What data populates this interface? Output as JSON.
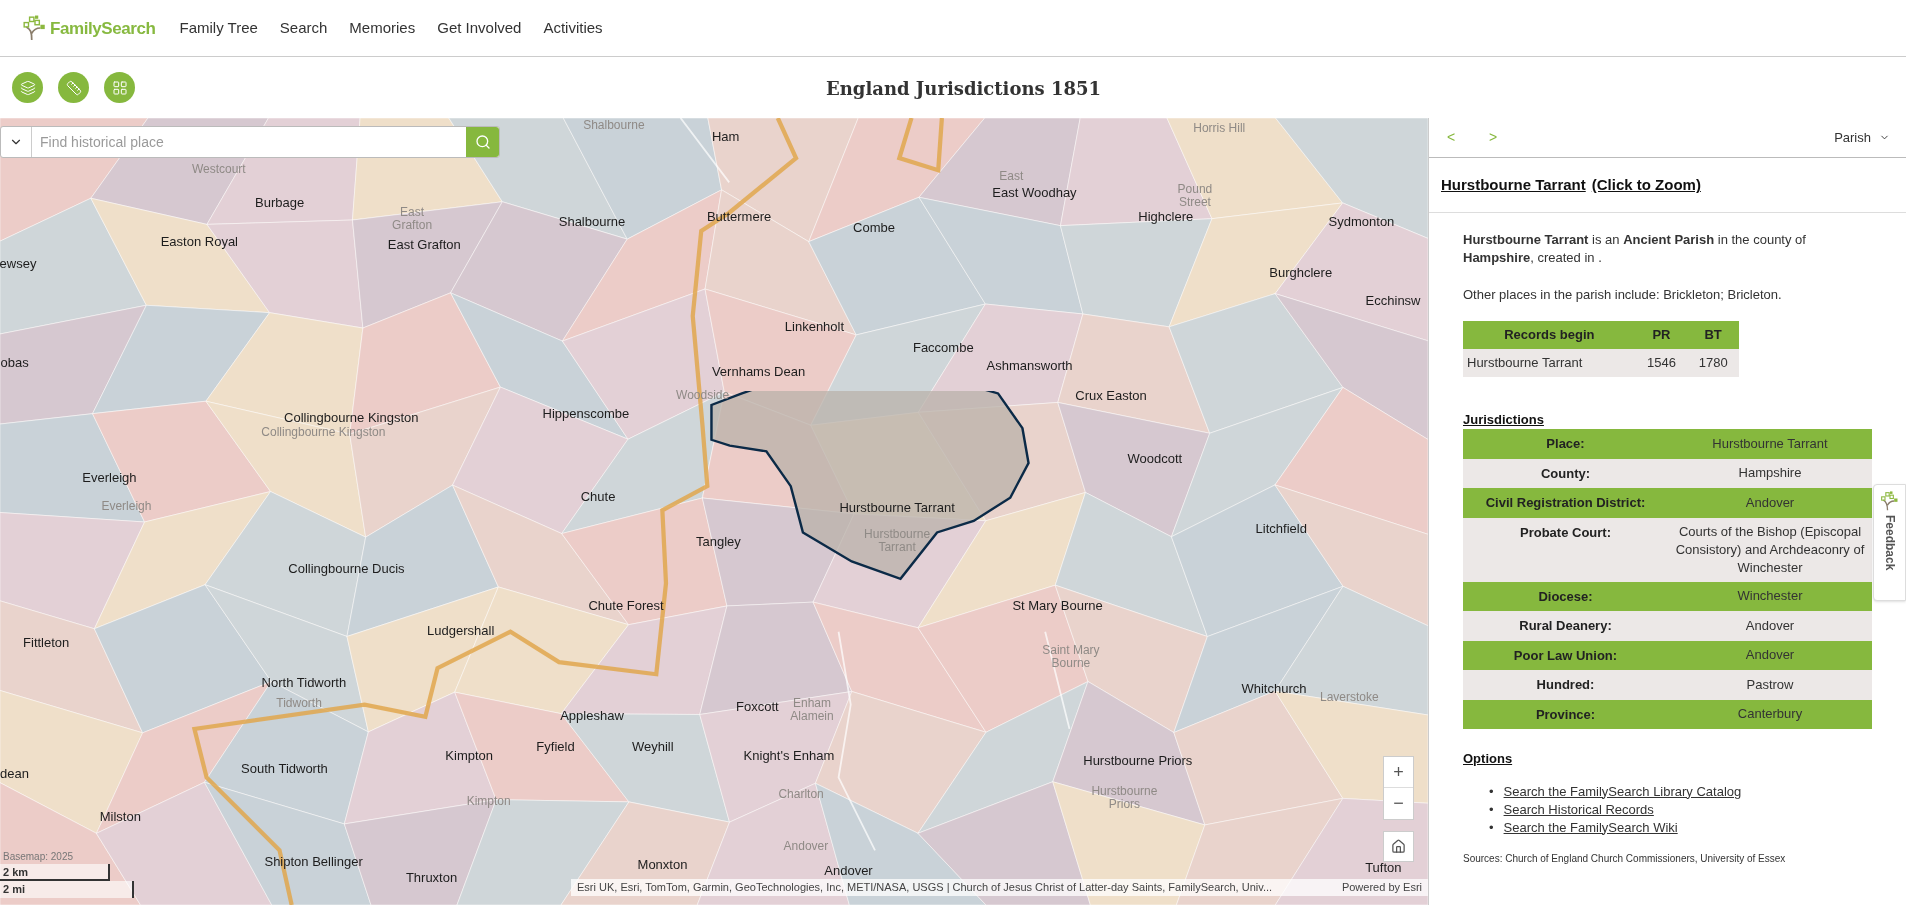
{
  "header": {
    "logo": "FamilySearch",
    "nav": [
      {
        "label": "Family Tree"
      },
      {
        "label": "Search"
      },
      {
        "label": "Memories"
      },
      {
        "label": "Get Involved"
      },
      {
        "label": "Activities"
      }
    ]
  },
  "toolbar": {
    "title": "England Jurisdictions 1851"
  },
  "map": {
    "search": {
      "placeholder": "Find historical place"
    },
    "labels": [
      {
        "text": "Ham",
        "kind": "parish"
      },
      {
        "text": "Burbage",
        "kind": "parish"
      },
      {
        "text": "East Woodhay",
        "kind": "parish"
      },
      {
        "text": "Shalbourne",
        "kind": "parish"
      },
      {
        "text": "Buttermere",
        "kind": "parish"
      },
      {
        "text": "Combe",
        "kind": "parish"
      },
      {
        "text": "Highclere",
        "kind": "parish"
      },
      {
        "text": "Sydmonton",
        "kind": "parish"
      },
      {
        "text": "Easton Royal",
        "kind": "parish"
      },
      {
        "text": "East Grafton",
        "kind": "parish"
      },
      {
        "text": "Burghclere",
        "kind": "parish"
      },
      {
        "text": "Ecchinsw",
        "kind": "parish"
      },
      {
        "text": "ewsey",
        "kind": "parish"
      },
      {
        "text": "Linkenholt",
        "kind": "parish"
      },
      {
        "text": "Faccombe",
        "kind": "parish"
      },
      {
        "text": "obas",
        "kind": "parish"
      },
      {
        "text": "Vernhams Dean",
        "kind": "parish"
      },
      {
        "text": "Ashmansworth",
        "kind": "parish"
      },
      {
        "text": "Crux Easton",
        "kind": "parish"
      },
      {
        "text": "Collingbourne Kingston",
        "kind": "parish"
      },
      {
        "text": "Hippenscombe",
        "kind": "parish"
      },
      {
        "text": "Woodcott",
        "kind": "parish"
      },
      {
        "text": "Everleigh",
        "kind": "parish"
      },
      {
        "text": "Chute",
        "kind": "parish"
      },
      {
        "text": "Hurstbourne Tarrant",
        "kind": "parish"
      },
      {
        "text": "Litchfield",
        "kind": "parish"
      },
      {
        "text": "Tangley",
        "kind": "parish"
      },
      {
        "text": "Collingbourne Ducis",
        "kind": "parish"
      },
      {
        "text": "Chute Forest",
        "kind": "parish"
      },
      {
        "text": "St Mary Bourne",
        "kind": "parish"
      },
      {
        "text": "Fittleton",
        "kind": "parish"
      },
      {
        "text": "Ludgershall",
        "kind": "parish"
      },
      {
        "text": "North Tidworth",
        "kind": "parish"
      },
      {
        "text": "Whitchurch",
        "kind": "parish"
      },
      {
        "text": "Appleshaw",
        "kind": "parish"
      },
      {
        "text": "Foxcott",
        "kind": "parish"
      },
      {
        "text": "Fyfield",
        "kind": "parish"
      },
      {
        "text": "Weyhill",
        "kind": "parish"
      },
      {
        "text": "Kimpton",
        "kind": "parish"
      },
      {
        "text": "South Tidworth",
        "kind": "parish"
      },
      {
        "text": "Knight's Enham",
        "kind": "parish"
      },
      {
        "text": "Hurstbourne Priors",
        "kind": "parish"
      },
      {
        "text": "dean",
        "kind": "parish"
      },
      {
        "text": "Milston",
        "kind": "parish"
      },
      {
        "text": "Shipton Bellinger",
        "kind": "parish"
      },
      {
        "text": "Thruxton",
        "kind": "parish"
      },
      {
        "text": "Monxton",
        "kind": "parish"
      },
      {
        "text": "Andover",
        "kind": "parish"
      },
      {
        "text": "Tufton",
        "kind": "parish"
      },
      {
        "text": "Shalbourne",
        "kind": "basemap"
      },
      {
        "text": "Horris Hill",
        "kind": "basemap"
      },
      {
        "text": "Westcourt",
        "kind": "basemap"
      },
      {
        "text": "East",
        "kind": "basemap"
      },
      {
        "text": "East Grafton",
        "kind": "basemap"
      },
      {
        "text": "Pound Street",
        "kind": "basemap"
      },
      {
        "text": "Woodside",
        "kind": "basemap"
      },
      {
        "text": "Collingbourne Kingston",
        "kind": "basemap"
      },
      {
        "text": "Everleigh",
        "kind": "basemap"
      },
      {
        "text": "Hurstbourne Tarrant",
        "kind": "basemap"
      },
      {
        "text": "Tidworth",
        "kind": "basemap"
      },
      {
        "text": "Enham Alamein",
        "kind": "basemap"
      },
      {
        "text": "Saint Mary Bourne",
        "kind": "basemap"
      },
      {
        "text": "Kimpton",
        "kind": "basemap"
      },
      {
        "text": "Charlton",
        "kind": "basemap"
      },
      {
        "text": "Laverstoke",
        "kind": "basemap"
      },
      {
        "text": "Hurstbourne Priors",
        "kind": "basemap"
      },
      {
        "text": "Andover",
        "kind": "basemap"
      }
    ],
    "zoom_in": "+",
    "zoom_out": "−",
    "basemap": "Basemap: 2025",
    "scale": [
      "2 km",
      "2 mi"
    ],
    "attribution": "Esri UK, Esri, TomTom, Garmin, GeoTechnologies, Inc, METI/NASA, USGS | Church of Jesus Christ of Latter-day Saints, FamilySearch, Univ...",
    "powered_by": "Powered by Esri"
  },
  "panel": {
    "prev": "<",
    "next": ">",
    "level_select": "Parish",
    "title": "Hurstbourne Tarrant",
    "zoom_link": "(Click to Zoom)",
    "description": "**Hurstbourne Tarrant** is an **Ancient Parish** in the county of **Hampshire**, created in .",
    "other_places": "Other places in the parish include: Brickleton; Bricleton.",
    "records": {
      "columns": [
        "Records begin",
        "PR",
        "BT"
      ],
      "rows": [
        [
          "Hurstbourne Tarrant",
          "1546",
          "1780"
        ]
      ]
    },
    "jurisdictions_heading": "Jurisdictions",
    "jurisdictions": [
      {
        "label": "Place:",
        "value": "Hurstbourne Tarrant"
      },
      {
        "label": "County:",
        "value": "Hampshire"
      },
      {
        "label": "Civil Registration District:",
        "value": "Andover"
      },
      {
        "label": "Probate Court:",
        "value": "Courts of the Bishop (Episcopal Consistory) and Archdeaconry of Winchester"
      },
      {
        "label": "Diocese:",
        "value": "Winchester"
      },
      {
        "label": "Rural Deanery:",
        "value": "Andover"
      },
      {
        "label": "Poor Law Union:",
        "value": "Andover"
      },
      {
        "label": "Hundred:",
        "value": "Pastrow"
      },
      {
        "label": "Province:",
        "value": "Canterbury"
      }
    ],
    "options_heading": "Options",
    "options": [
      {
        "bullet": "•",
        "label": "Search the FamilySearch Library Catalog"
      },
      {
        "bullet": "•",
        "label": "Search Historical Records"
      },
      {
        "bullet": "•",
        "label": "Search the FamilySearch Wiki"
      }
    ],
    "sources": "Sources: Church of England Church Commissioners, University of Essex"
  },
  "feedback": "Feedback"
}
